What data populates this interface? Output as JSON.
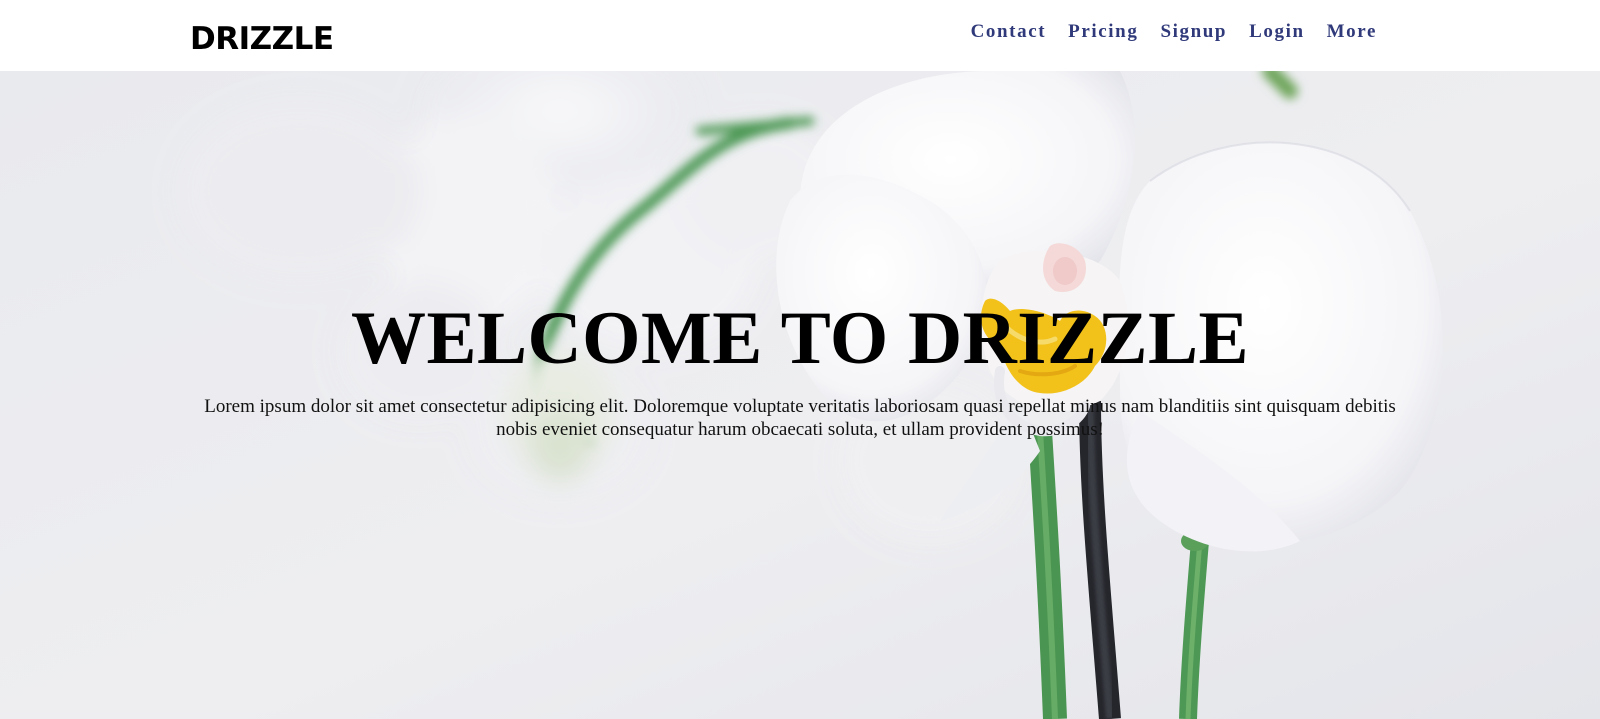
{
  "brand": {
    "name": "DRIZZLE"
  },
  "nav": {
    "color": "#303a7a",
    "items": [
      {
        "key": "contact",
        "label": "Contact"
      },
      {
        "key": "pricing",
        "label": "Pricing"
      },
      {
        "key": "signup",
        "label": "Signup"
      },
      {
        "key": "login",
        "label": "Login"
      },
      {
        "key": "more",
        "label": "More"
      }
    ]
  },
  "hero": {
    "title": "WELCOME TO DRIZZLE",
    "text": "Lorem ipsum dolor sit amet consectetur adipisicing elit. Doloremque voluptate veritatis laboriosam quasi repellat minus nam blanditiis sint quisquam debitis nobis eveniet consequatur harum obcaecati soluta, et ullam provident possimus!",
    "background_image": "white-orchid-photo",
    "colors": {
      "background": "#ebebee",
      "petal": "#fbfbfd",
      "stem": "#4f9a57",
      "center": "#f2c21a"
    }
  }
}
